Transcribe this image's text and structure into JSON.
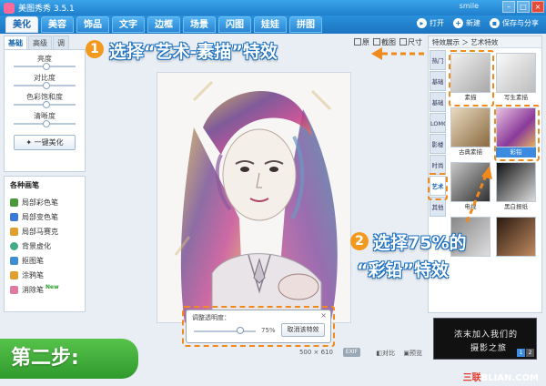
{
  "titlebar": {
    "app_title": "美图秀秀 3.5.1",
    "user": "smile",
    "win_min": "–",
    "win_max": "□",
    "win_close": "×"
  },
  "main_tabs": [
    {
      "label": "美化",
      "active": true
    },
    {
      "label": "美容"
    },
    {
      "label": "饰品"
    },
    {
      "label": "文字"
    },
    {
      "label": "边框"
    },
    {
      "label": "场景"
    },
    {
      "label": "闪图"
    },
    {
      "label": "娃娃"
    },
    {
      "label": "拼图"
    }
  ],
  "main_actions": {
    "open": "打开",
    "new": "新建",
    "save_share": "保存与分享"
  },
  "left_panel": {
    "subtabs": [
      "基础",
      "高级",
      "调"
    ],
    "sliders": [
      {
        "label": "亮度",
        "value": 0.5
      },
      {
        "label": "对比度",
        "value": 0.5
      },
      {
        "label": "色彩饱和度",
        "value": 0.5
      },
      {
        "label": "清晰度",
        "value": 0.5
      }
    ],
    "one_key_button": "一键美化",
    "brush_title": "各种画笔",
    "brushes": [
      {
        "label": "局部彩色笔",
        "color": "#4a9a3a"
      },
      {
        "label": "局部变色笔",
        "color": "#3a7ad6"
      },
      {
        "label": "局部马赛克",
        "color": "#e0a030"
      },
      {
        "label": "背景虚化",
        "color": "#44aa88"
      },
      {
        "label": "抠图笔",
        "color": "#3f8fd0"
      },
      {
        "label": "涂鸦笔",
        "color": "#e0a030"
      },
      {
        "label": "消除笔",
        "color": "#e07aa0",
        "badge": "New"
      }
    ]
  },
  "toolbar": {
    "border_toggle": "原",
    "screenshot": "截图",
    "size": "尺寸"
  },
  "opacity_panel": {
    "label": "调整透明度：",
    "value": "75%",
    "value_fraction": 0.75,
    "cancel": "取消该特效",
    "close": "×"
  },
  "status": {
    "dimensions": "500 × 610",
    "exif": "EXIF",
    "compare": "对比",
    "preview": "预览"
  },
  "right_panel": {
    "title": "特效展示 ＞ 艺术特效",
    "categories": [
      {
        "label": "热门"
      },
      {
        "label": "基础"
      },
      {
        "label": "基础"
      },
      {
        "label": "LOMO"
      },
      {
        "label": "影楼"
      },
      {
        "label": "时尚"
      },
      {
        "label": "艺术",
        "active": true
      },
      {
        "label": "其他"
      }
    ],
    "thumbs": [
      {
        "label": "素描"
      },
      {
        "label": "写生素描"
      },
      {
        "label": "古典素描"
      },
      {
        "label": "彩铅",
        "selected": true
      },
      {
        "label": "电视"
      },
      {
        "label": "黑白报纸"
      },
      {
        "label": ""
      },
      {
        "label": ""
      }
    ]
  },
  "ad": {
    "line1": "浓末加入我们的",
    "line2": "摄影之旅",
    "pages": [
      "1",
      "2"
    ]
  },
  "callouts": {
    "step1_badge": "1",
    "step1_text": "选择“艺术-素描”特效",
    "step2_badge": "2",
    "step2_line1": "选择75%的",
    "step2_line2": "“彩铅”特效"
  },
  "stage_label": "第二步:",
  "watermark": {
    "red": "三联",
    "rest": "BLIAN.COM"
  },
  "colors": {
    "accent_blue": "#1f7fcc",
    "highlight_orange": "#f08a1c",
    "stage_green": "#3aa83a"
  }
}
